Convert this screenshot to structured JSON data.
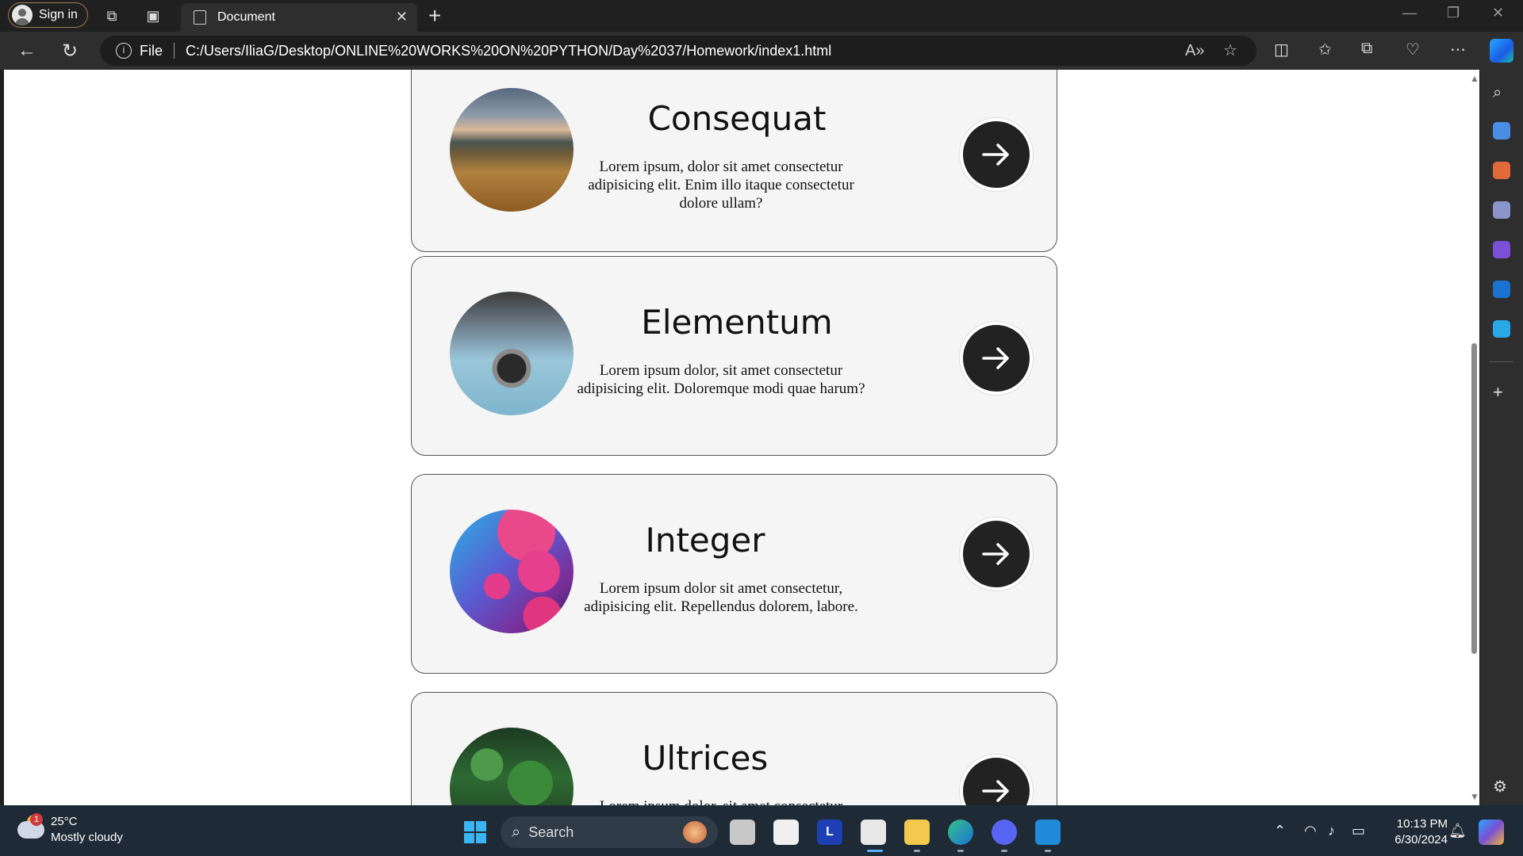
{
  "browser": {
    "sign_in_label": "Sign in",
    "tab_title": "Document",
    "address_prefix": "File",
    "url": "C:/Users/IliaG/Desktop/ONLINE%20WORKS%20ON%20PYTHON/Day%2037/Homework/index1.html"
  },
  "cards": [
    {
      "title": "Consequat",
      "description": "Lorem ipsum, dolor sit amet consectetur adipisicing elit. Enim illo itaque consectetur dolore ullam?",
      "image": "mountain-field"
    },
    {
      "title": "Elementum",
      "description": "Lorem ipsum dolor, sit amet consectetur adipisicing elit. Doloremque modi quae harum?",
      "image": "camera"
    },
    {
      "title": "Integer",
      "description": "Lorem ipsum dolor sit amet consectetur, adipisicing elit. Repellendus dolorem, labore.",
      "image": "abstract-planets"
    },
    {
      "title": "Ultrices",
      "description": "Lorem ipsum dolor, sit amet consectetur",
      "image": "forest"
    }
  ],
  "taskbar": {
    "weather_temp": "25°C",
    "weather_condition": "Mostly cloudy",
    "weather_badge": "1",
    "search_placeholder": "Search",
    "time": "10:13 PM",
    "date": "6/30/2024"
  },
  "icons": {
    "card_action": "arrow-right-icon",
    "accent_dark": "#222222"
  }
}
